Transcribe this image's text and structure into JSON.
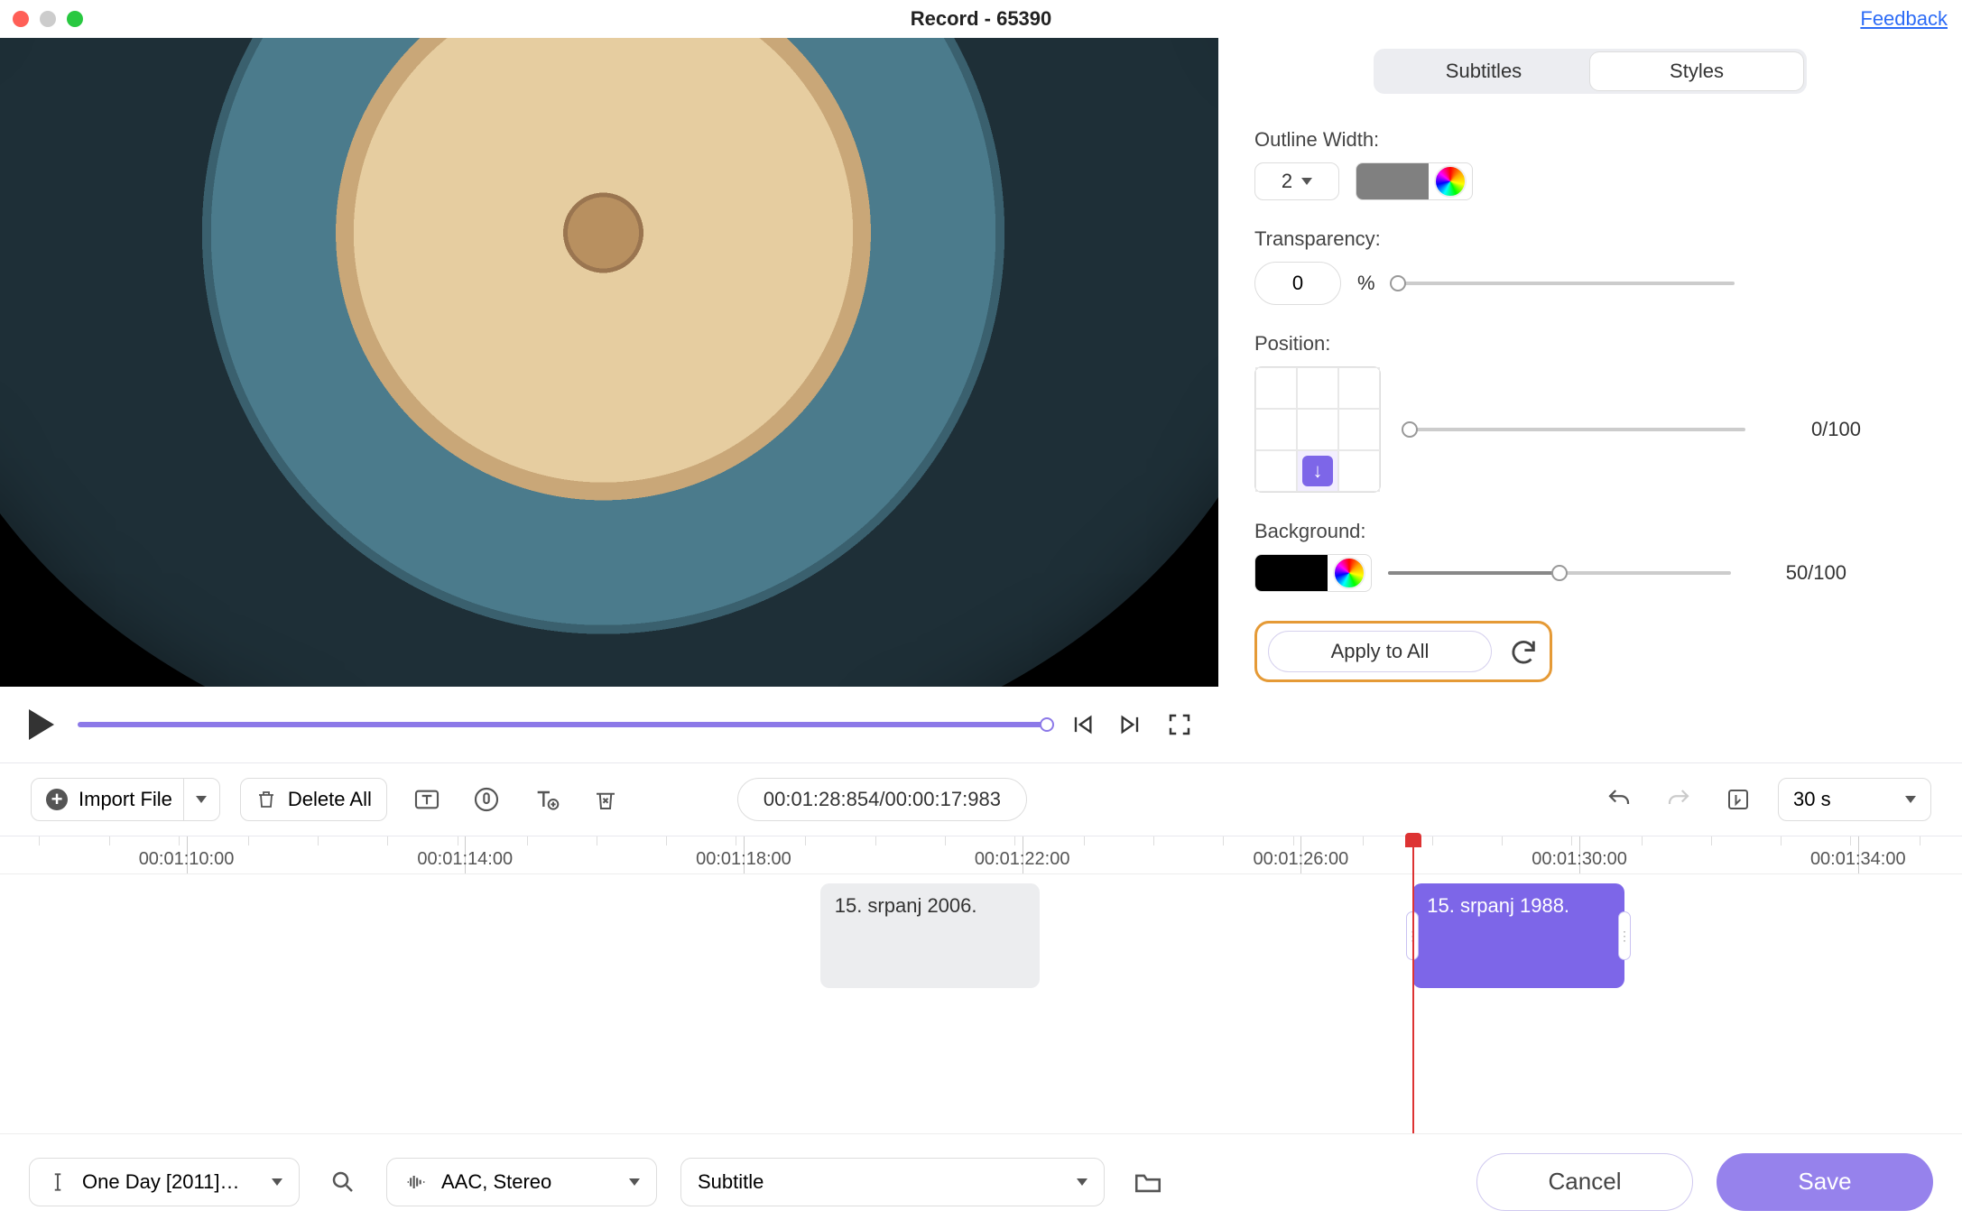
{
  "titlebar": {
    "title": "Record - 65390",
    "feedback": "Feedback"
  },
  "panel": {
    "tabs": {
      "subtitles": "Subtitles",
      "styles": "Styles"
    },
    "outline": {
      "label": "Outline Width:",
      "value": "2",
      "swatch": "#808080"
    },
    "transparency": {
      "label": "Transparency:",
      "value": "0",
      "unit": "%"
    },
    "position": {
      "label": "Position:",
      "readout": "0/100"
    },
    "background": {
      "label": "Background:",
      "swatch": "#000000",
      "readout": "50/100"
    },
    "apply_label": "Apply to All"
  },
  "toolbar": {
    "import": "Import File",
    "delete_all": "Delete All",
    "tc_current": "00:01:28:854",
    "tc_sep": "/",
    "tc_total": "00:00:17:983",
    "zoom": "30 s"
  },
  "timeline": {
    "labels": [
      "00:01:10:00",
      "00:01:14:00",
      "00:01:18:00",
      "00:01:22:00",
      "00:01:26:00",
      "00:01:30:00",
      "00:01:34:00"
    ],
    "clips": [
      {
        "id": "clip-1",
        "text": "15. srpanj 2006.",
        "kind": "gray",
        "left_pct": 41.8,
        "width_pct": 11.2
      },
      {
        "id": "clip-2",
        "text": "15. srpanj 1988.",
        "kind": "purple",
        "left_pct": 72.0,
        "width_pct": 10.8
      }
    ],
    "playhead_pct": 72.0
  },
  "footer": {
    "video_name": "One Day [2011]…",
    "audio_fmt": "AAC, Stereo",
    "track_type": "Subtitle",
    "cancel": "Cancel",
    "save": "Save"
  }
}
